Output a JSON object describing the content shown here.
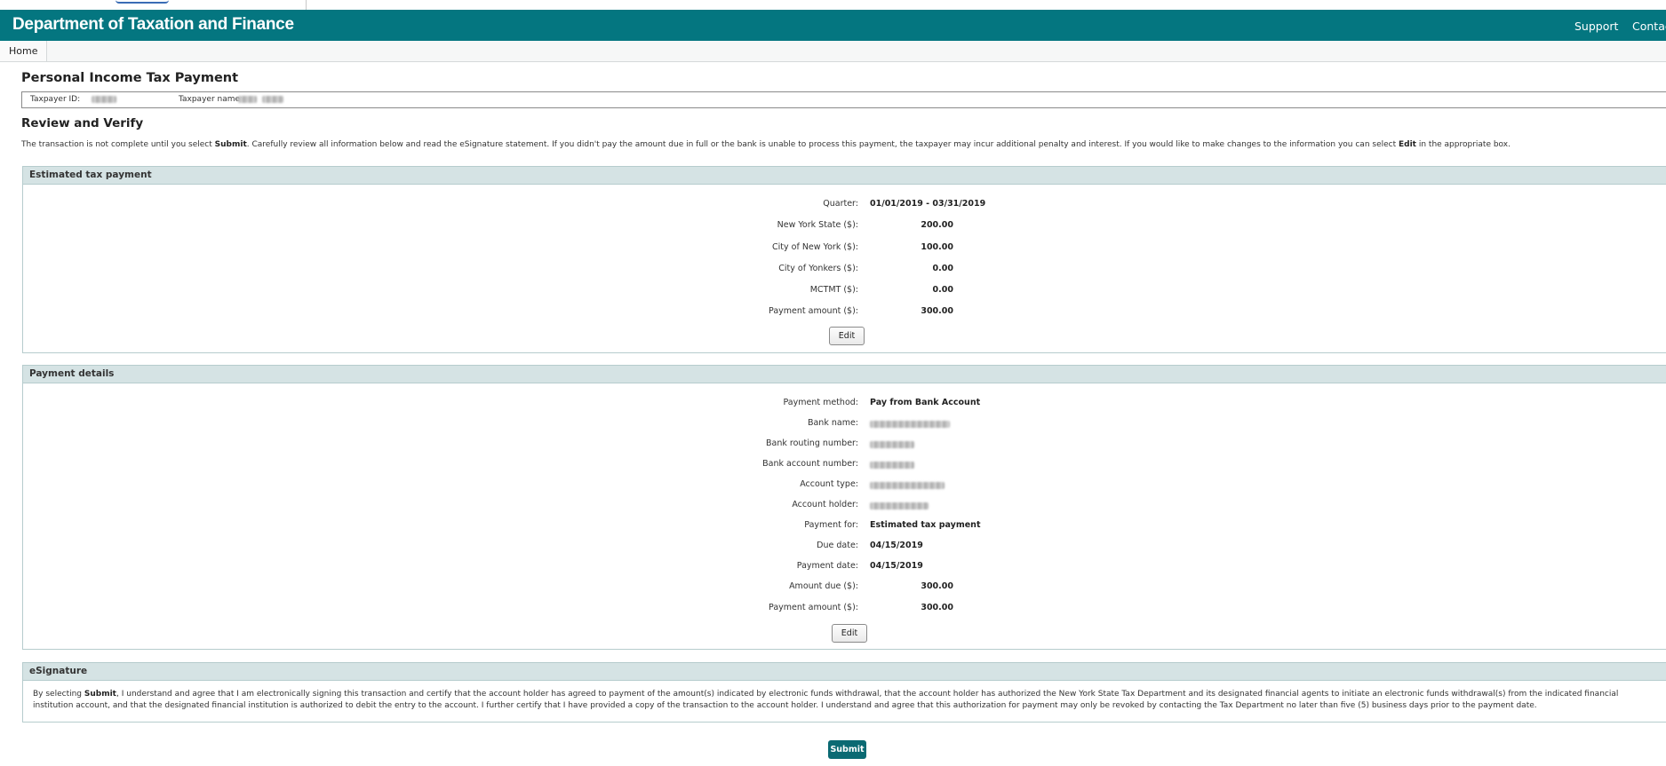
{
  "header": {
    "title": "Department of Taxation and Finance",
    "nav": {
      "support": "Support",
      "contact": "Contac"
    }
  },
  "breadcrumb": {
    "home": "Home"
  },
  "page": {
    "title": "Personal Income Tax Payment",
    "taxpayer_id_label": "Taxpayer ID:",
    "taxpayer_name_label": "Taxpayer name:",
    "review_title": "Review and Verify",
    "review_text": {
      "part1": "The transaction is not complete until you select ",
      "bold1": "Submit",
      "part2": ". Carefully review all information below and read the eSignature statement. If you didn't pay the amount due in full or the bank is unable to process this payment, the taxpayer may incur additional penalty and interest. If you would like to make changes to the information you can select ",
      "bold2": "Edit",
      "part3": " in the appropriate box."
    }
  },
  "estimated": {
    "header": "Estimated tax payment",
    "quarter_label": "Quarter:",
    "quarter_value": "01/01/2019 - 03/31/2019",
    "nys_label": "New York State ($):",
    "nys_value": "200.00",
    "nyc_label": "City of New York ($):",
    "nyc_value": "100.00",
    "yonkers_label": "City of Yonkers ($):",
    "yonkers_value": "0.00",
    "mctmt_label": "MCTMT ($):",
    "mctmt_value": "0.00",
    "amount_label": "Payment amount ($):",
    "amount_value": "300.00",
    "edit_label": "Edit"
  },
  "payment": {
    "header": "Payment details",
    "method_label": "Payment method:",
    "method_value": "Pay from Bank Account",
    "bank_name_label": "Bank name:",
    "routing_label": "Bank routing number:",
    "account_number_label": "Bank account number:",
    "account_type_label": "Account type:",
    "holder_label": "Account holder:",
    "for_label": "Payment for:",
    "for_value": "Estimated tax payment",
    "due_date_label": "Due date:",
    "due_date_value": "04/15/2019",
    "pay_date_label": "Payment date:",
    "pay_date_value": "04/15/2019",
    "amount_due_label": "Amount due ($):",
    "amount_due_value": "300.00",
    "amount_label": "Payment amount ($):",
    "amount_value": "300.00",
    "edit_label": "Edit"
  },
  "esignature": {
    "header": "eSignature",
    "part1": "By selecting ",
    "bold": "Submit",
    "part2": ", I understand and agree that I am electronically signing this transaction and certify that the account holder has agreed to payment of the amount(s) indicated by electronic funds withdrawal, that the account holder has authorized the New York State Tax Department and its designated financial agents to initiate an electronic funds withdrawal(s) from the indicated financial institution account, and that the designated financial institution is authorized to debit the entry to the account. I further certify that I have provided a copy of the transaction to the account holder. I understand and agree that this authorization for payment may only be revoked by contacting the Tax Department no later than five (5) business days prior to the payment date."
  },
  "submit_label": "Submit",
  "colors": {
    "header_bg": "#047680",
    "panel_head_bg": "#d5e3e4",
    "submit_bg": "#0b6a73"
  }
}
